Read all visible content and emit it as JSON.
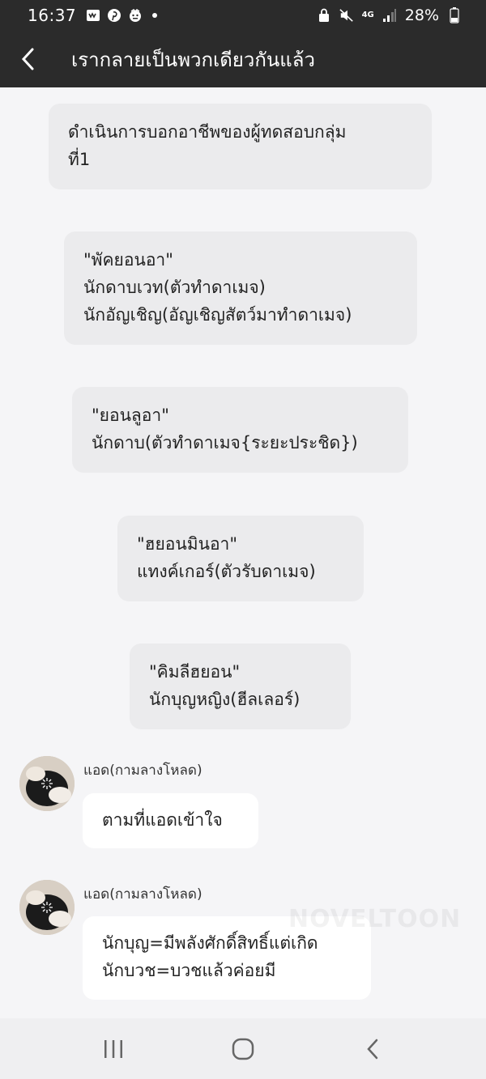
{
  "status_bar": {
    "time": "16:37",
    "network": "4G",
    "battery": "28%"
  },
  "app_bar": {
    "title": "เรากลายเป็นพวกเดียวกันแล้ว"
  },
  "messages": [
    {
      "text": "ดำเนินการบอกอาชีพของผู้ทดสอบกลุ่ม\nที่1"
    },
    {
      "text": "\"พัคยอนอา\"\nนักดาบเวท(ตัวทำดาเมจ)\nนักอัญเชิญ(อัญเชิญสัตว์มาทำดาเมจ)"
    },
    {
      "text": "\"ยอนลูอา\"\nนักดาบ(ตัวทำดาเมจ{ระยะประชิด})"
    },
    {
      "text": "\"ฮยอนมินอา\"\nแทงค์เกอร์(ตัวรับดาเมจ)"
    },
    {
      "text": "\"คิมลีฮยอน\"\nนักบุญหญิง(ฮีลเลอร์)"
    }
  ],
  "comments": [
    {
      "sender": "แอด(กามลางโหลด)",
      "text": "ตามที่แอดเข้าใจ"
    },
    {
      "sender": "แอด(กามลางโหลด)",
      "text": "นักบุญ=มีพลังศักดิ์สิทธิ์แต่เกิด\nนักบวช=บวชแล้วค่อยมี"
    }
  ],
  "watermark": "NOVELTOON",
  "colors": {
    "header_bg": "#2b2b2b",
    "chat_bg": "#f5f5f7",
    "center_bubble": "#ebebed",
    "comment_bubble": "#ffffff"
  }
}
